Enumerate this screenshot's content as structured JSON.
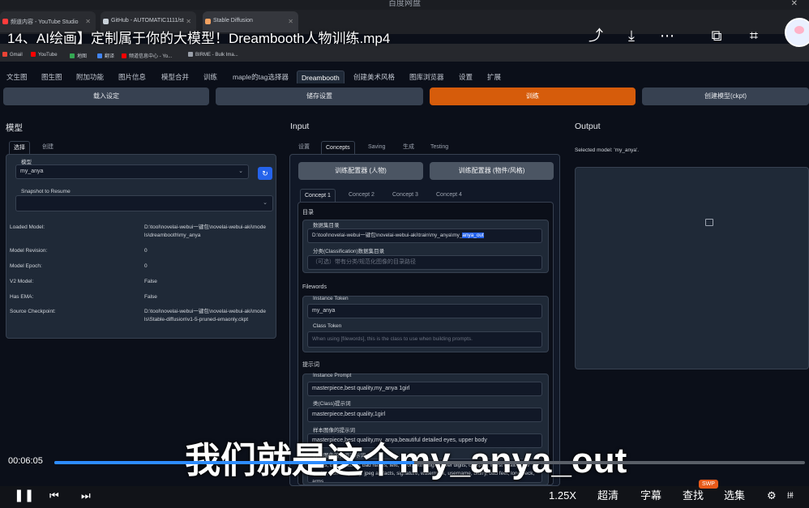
{
  "player": {
    "window_title": "百度网盘",
    "video_title": "14、AI绘画】定制属于你的大模型！Dreambooth人物训练.mp4",
    "subtitle": "我们就是这个my_anya_out",
    "time": "00:06:05",
    "progress": 0.48,
    "speed": "1.25X",
    "quality": "超清",
    "captions": "字幕",
    "search": "查找",
    "episodes": "选集",
    "swp_badge": "SWP",
    "ime": "拼"
  },
  "browser": {
    "tabs": [
      {
        "label": "频道内容 - YouTube Studio",
        "color": "#ff3b3b"
      },
      {
        "label": "GitHub - AUTOMATIC1111/st",
        "color": "#c9d1d9"
      },
      {
        "label": "Stable Diffusion",
        "color": "#f4a261"
      }
    ],
    "bookmarks": [
      {
        "label": "Gmail",
        "color": "#ea4335"
      },
      {
        "label": "YouTube",
        "color": "#ff0000"
      },
      {
        "label": "地图",
        "color": "#34a853"
      },
      {
        "label": "翻译",
        "color": "#4285f4"
      },
      {
        "label": "频道信息中心 - Yo...",
        "color": "#ff0000"
      },
      {
        "label": "BIRME - Bulk Ima...",
        "color": "#9aa0aa"
      }
    ]
  },
  "app": {
    "nav": [
      "文生图",
      "图生图",
      "附加功能",
      "图片信息",
      "模型合并",
      "训练",
      "maple的tag选择器",
      "Dreambooth",
      "创建美术风格",
      "图库浏览器",
      "设置",
      "扩展"
    ],
    "actions": {
      "load": "载入设定",
      "save": "储存设置",
      "train": "训练",
      "create": "创建模型(ckpt)"
    },
    "model": {
      "title": "模型",
      "tabs": [
        "选择",
        "创建"
      ],
      "model_label": "模型",
      "model_value": "my_anya",
      "snapshot_label": "Snapshot to Resume",
      "info": [
        {
          "k": "Loaded Model:",
          "v": "D:\\tool\\novelai-webui一键包\\novelai-webui-aki\\models\\dreambooth\\my_anya"
        },
        {
          "k": "Model Revision:",
          "v": "0"
        },
        {
          "k": "Model Epoch:",
          "v": "0"
        },
        {
          "k": "V2 Model:",
          "v": "False"
        },
        {
          "k": "Has EMA:",
          "v": "False"
        },
        {
          "k": "Source Checkpoint:",
          "v": "D:\\tool\\novelai-webui一键包\\novelai-webui-aki\\models\\Stable-diffusion\\v1-5-pruned-emaonly.ckpt"
        }
      ]
    },
    "input": {
      "title": "Input",
      "tabs": [
        "设置",
        "Concepts",
        "Saving",
        "生成",
        "Testing"
      ],
      "wizard_person": "训练配置器 (人物)",
      "wizard_object": "训练配置器 (物件/风格)",
      "concept_tabs": [
        "Concept 1",
        "Concept 2",
        "Concept 3",
        "Concept 4"
      ],
      "dir_section": "目录",
      "dataset_label": "数据集目录",
      "dataset_value": "D:\\tool\\novelai-webui一键包\\novelai-webui-aki\\train\\my_anya\\my_",
      "dataset_selected": "anya_out",
      "class_dir_label": "分类(Classification)数据集目录",
      "class_dir_placeholder": "（可选）带有分类/规范化图像的目录路径",
      "filewords": "Filewords",
      "instance_token_label": "Instance Token",
      "instance_token": "my_anya",
      "class_token_label": "Class Token",
      "class_token_placeholder": "When using [filewords], this is the class to use when building prompts.",
      "prompt_section": "提示词",
      "instance_prompt_label": "Instance Prompt",
      "instance_prompt": "masterpiece,best quality,my_anya 1girl",
      "class_prompt_label": "类(Class)提示词",
      "class_prompt": "masterpiece,best quality,1girl",
      "sample_prompt_label": "样本图像的提示词",
      "sample_prompt": "masterpiece,best quality,my_anya,beautiful detailed eyes, upper body",
      "neg_label": "样本图像的负面提示词",
      "neg_prompt": "lowres, bad anatomy, bad hands, text, error, extra digit, fewer digits, cropped, worst quality, low quality, normal quality, jpeg artifacts, signature, watermark, username, blurry, bad feet, long neck, arms"
    },
    "output": {
      "title": "Output",
      "status": "Selected model: 'my_anya'."
    }
  }
}
